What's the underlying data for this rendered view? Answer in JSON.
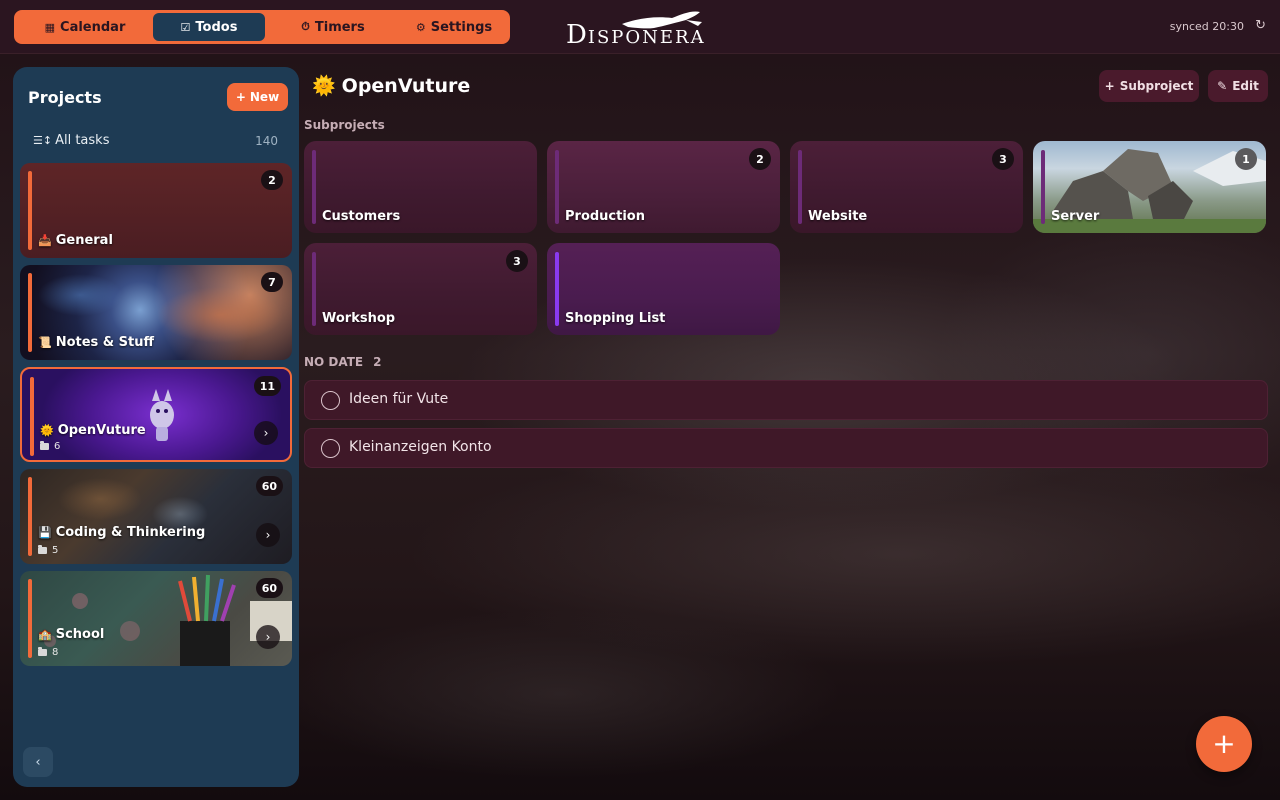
{
  "nav": {
    "tabs": [
      {
        "label": "Calendar",
        "icon": "calendar-icon"
      },
      {
        "label": "Todos",
        "icon": "checkbox-icon"
      },
      {
        "label": "Timers",
        "icon": "stopwatch-icon"
      },
      {
        "label": "Settings",
        "icon": "gear-icon"
      }
    ],
    "active_tab": "Todos",
    "accent": "#f26a3a"
  },
  "brand": {
    "logo_text_first": "D",
    "logo_text_rest": "ISPONERA"
  },
  "status": {
    "synced": "synced 20:30"
  },
  "sidebar": {
    "title": "Projects",
    "new_label": "New",
    "all_tasks_label": "All tasks",
    "all_tasks_count": "140",
    "projects": [
      {
        "emoji": "📥",
        "name": "General",
        "count": "2",
        "subprojects": "",
        "bg": "#5a2326"
      },
      {
        "emoji": "📜",
        "name": "Notes & Stuff",
        "count": "7",
        "subprojects": "",
        "bg": "#142035"
      },
      {
        "emoji": "🌞",
        "name": "OpenVuture",
        "count": "11",
        "subprojects": "6",
        "bg": "#4a1890"
      },
      {
        "emoji": "💾",
        "name": "Coding & Thinkering",
        "count": "60",
        "subprojects": "5",
        "bg": "#3a2c24"
      },
      {
        "emoji": "🏫",
        "name": "School",
        "count": "60",
        "subprojects": "8",
        "bg": "#2f4844"
      }
    ]
  },
  "main": {
    "title_emoji": "🌞",
    "title": "OpenVuture",
    "subproject_button": "Subproject",
    "edit_button": "Edit",
    "subprojects_label": "Subprojects",
    "subprojects": [
      {
        "name": "Customers",
        "count": ""
      },
      {
        "name": "Production",
        "count": "2"
      },
      {
        "name": "Website",
        "count": "3"
      },
      {
        "name": "Server",
        "count": "1"
      },
      {
        "name": "Workshop",
        "count": "3"
      },
      {
        "name": "Shopping List",
        "count": ""
      }
    ],
    "no_date_label": "NO DATE",
    "no_date_count": "2",
    "tasks": [
      {
        "title": "Ideen für Vute"
      },
      {
        "title": "Kleinanzeigen Konto"
      }
    ]
  }
}
